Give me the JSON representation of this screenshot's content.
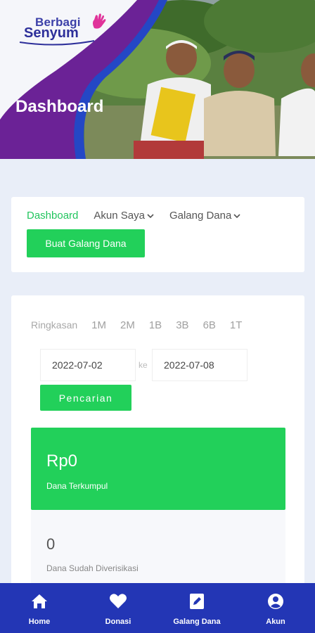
{
  "brand": {
    "line1": "Berbagi",
    "line2": "Senyum",
    "accent": "#e0339a",
    "color": "#2d2f9a"
  },
  "header": {
    "title": "Dashboard"
  },
  "menu": {
    "items": [
      {
        "label": "Dashboard",
        "active": true
      },
      {
        "label": "Akun Saya",
        "dropdown": true
      },
      {
        "label": "Galang Dana",
        "dropdown": true
      }
    ],
    "create_button": "Buat Galang Dana"
  },
  "summary": {
    "range_label": "Ringkasan",
    "range_options": [
      "1M",
      "2M",
      "1B",
      "3B",
      "6B",
      "1T"
    ],
    "date_from": "2022-07-02",
    "date_separator": "ke",
    "date_to": "2022-07-08",
    "search_button": "Pencarian",
    "stats": [
      {
        "amount": "Rp0",
        "label": "Dana Terkumpul"
      },
      {
        "amount": "0",
        "label": "Dana Sudah Diverisikasi"
      }
    ]
  },
  "bottom_nav": [
    {
      "label": "Home",
      "icon": "home-icon"
    },
    {
      "label": "Donasi",
      "icon": "heart-icon"
    },
    {
      "label": "Galang Dana",
      "icon": "edit-icon"
    },
    {
      "label": "Akun",
      "icon": "account-icon"
    }
  ],
  "colors": {
    "primary_green": "#22d05a",
    "nav_blue": "#2336b5",
    "purple": "#6b2296"
  }
}
